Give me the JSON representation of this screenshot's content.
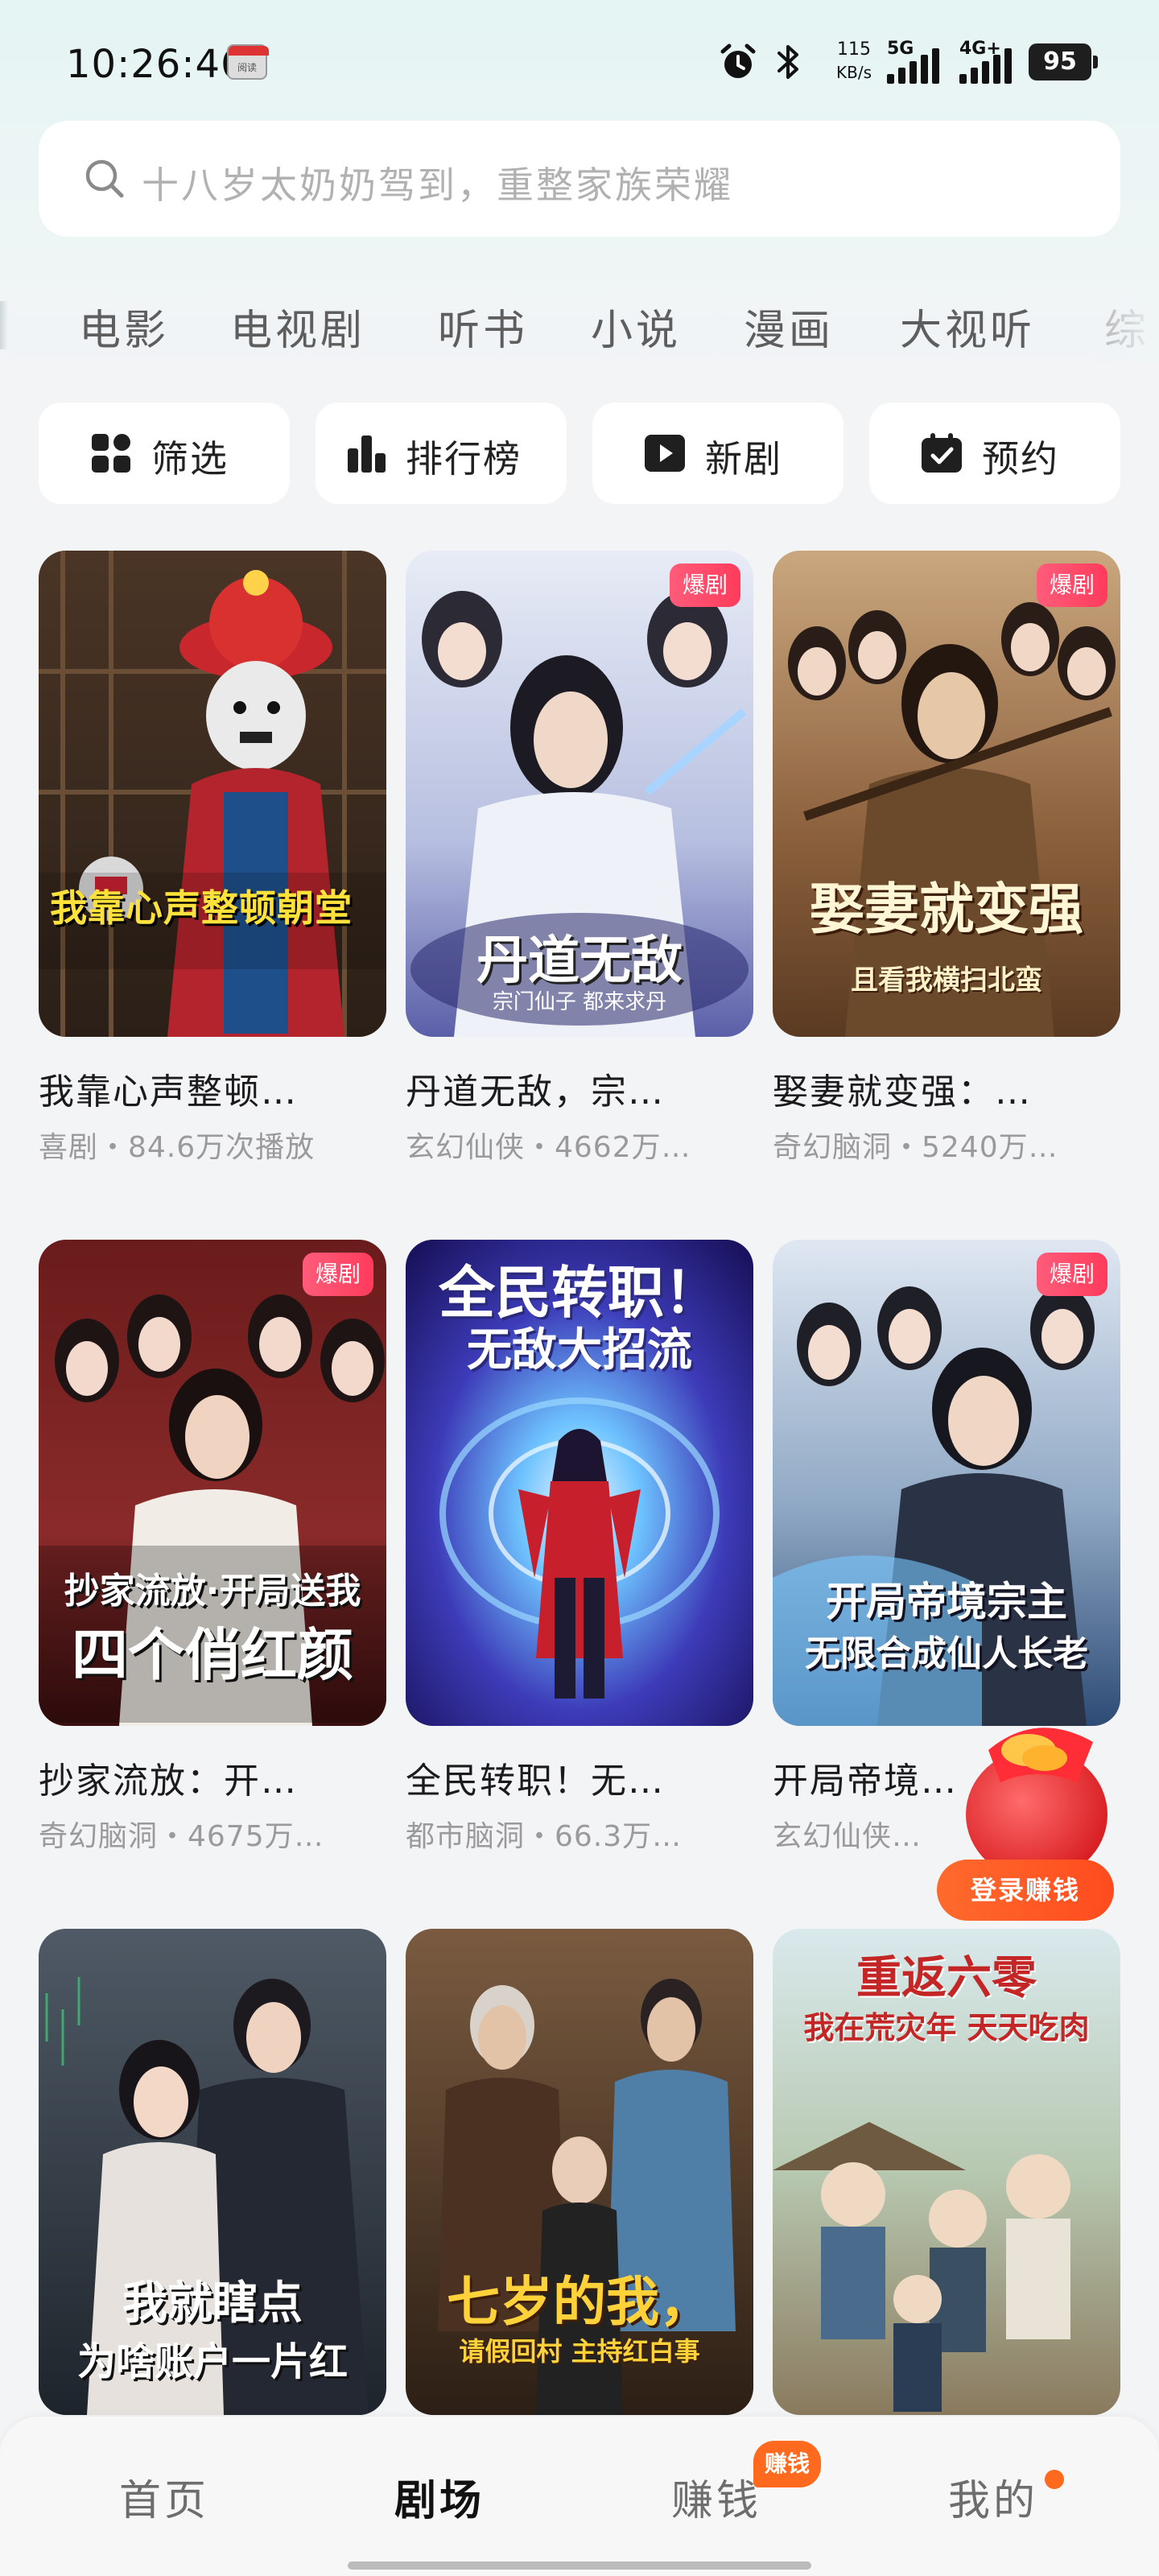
{
  "status_bar": {
    "time": "10:26:46",
    "reader_badge": "阅读",
    "net_speed_value": "115",
    "net_speed_unit": "KB/s",
    "signal1": "5G",
    "signal2": "4G+",
    "battery": "95"
  },
  "search": {
    "placeholder": "十八岁太奶奶驾到，重整家族荣耀"
  },
  "categories": [
    "电影",
    "电视剧",
    "听书",
    "小说",
    "漫画",
    "大视听",
    "综"
  ],
  "quick_buttons": [
    {
      "label": "筛选",
      "icon": "grid-filter-icon"
    },
    {
      "label": "排行榜",
      "icon": "bar-chart-icon"
    },
    {
      "label": "新剧",
      "icon": "play-square-icon"
    },
    {
      "label": "预约",
      "icon": "calendar-check-icon"
    }
  ],
  "cards": [
    {
      "title": "我靠心声整顿…",
      "meta": "喜剧・84.6万次播放",
      "badge": "",
      "poster_text": "我靠心声整顿朝堂",
      "poster_sub": ""
    },
    {
      "title": "丹道无敌，宗…",
      "meta": "玄幻仙侠・4662万…",
      "badge": "爆剧",
      "poster_text": "丹道无敌",
      "poster_sub": "宗门仙子 都来求丹"
    },
    {
      "title": "娶妻就变强：…",
      "meta": "奇幻脑洞・5240万…",
      "badge": "爆剧",
      "poster_text": "娶妻就变强",
      "poster_sub": "且看我横扫北蛮"
    },
    {
      "title": "抄家流放：开…",
      "meta": "奇幻脑洞・4675万…",
      "badge": "爆剧",
      "poster_text": "抄家流放·开局送我",
      "poster_sub": "四个俏红颜"
    },
    {
      "title": "全民转职！无…",
      "meta": "都市脑洞・66.3万…",
      "badge": "",
      "poster_text": "全民转职！",
      "poster_sub": "无敌大招流"
    },
    {
      "title": "开局帝境…",
      "meta": "玄幻仙侠…",
      "badge": "爆剧",
      "poster_text": "开局帝境宗主",
      "poster_sub": "无限合成仙人长老"
    },
    {
      "title": "",
      "meta": "",
      "badge": "",
      "poster_text": "我就瞎点",
      "poster_sub": "为啥账户一片红"
    },
    {
      "title": "",
      "meta": "",
      "badge": "",
      "poster_text": "七岁的我，",
      "poster_sub": "请假回村 主持红白事"
    },
    {
      "title": "",
      "meta": "",
      "badge": "",
      "poster_text": "重返六零",
      "poster_sub": "我在荒灾年 天天吃肉"
    }
  ],
  "float_promo": {
    "label": "登录赚钱"
  },
  "bottom_nav": {
    "items": [
      "首页",
      "剧场",
      "赚钱",
      "我的"
    ],
    "active": "剧场",
    "earn_badge": "赚钱"
  },
  "colors": {
    "accent": "#ff6a1e",
    "hot_badge": "#ff3b5c"
  }
}
